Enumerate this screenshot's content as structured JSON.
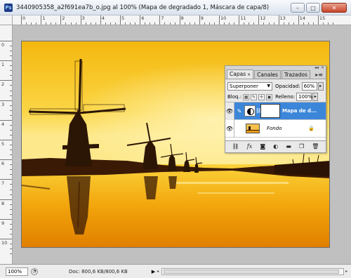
{
  "window": {
    "title": "3440905358_a2f691ea7b_o.jpg al 100% (Mapa de degradado 1, Máscara de capa/8)",
    "app_icon": "Ps",
    "min_label": "–",
    "max_label": "□",
    "close_label": "✕"
  },
  "rulers": {
    "top_ticks": [
      "0",
      "1",
      "2",
      "3",
      "4",
      "5",
      "6",
      "7",
      "8",
      "9",
      "10",
      "11",
      "12",
      "13",
      "14",
      "15"
    ],
    "left_ticks": [
      "0",
      "1",
      "2",
      "3",
      "4",
      "5",
      "6",
      "7",
      "8",
      "9",
      "10"
    ]
  },
  "layers_panel": {
    "tabs": [
      {
        "label": "Capas",
        "close": "×"
      },
      {
        "label": "Canales",
        "close": ""
      },
      {
        "label": "Trazados",
        "close": ""
      }
    ],
    "menu_icon": "▸≡",
    "blend_mode": "Superponer",
    "opacity_label": "Opacidad:",
    "opacity_value": "60%",
    "lock_label": "Bloq.:",
    "fill_label": "Relleno:",
    "fill_value": "100%",
    "layers": [
      {
        "name": "Mapa de d...",
        "selected": true
      },
      {
        "name": "Fondo",
        "selected": false
      }
    ],
    "footer_icons": [
      "link-icon",
      "fx-icon",
      "mask-icon",
      "adjustment-icon",
      "folder-icon",
      "new-layer-icon",
      "trash-icon"
    ]
  },
  "status": {
    "zoom": "100%",
    "doc_info": "Doc: 800,6 KB/800,6 KB"
  }
}
